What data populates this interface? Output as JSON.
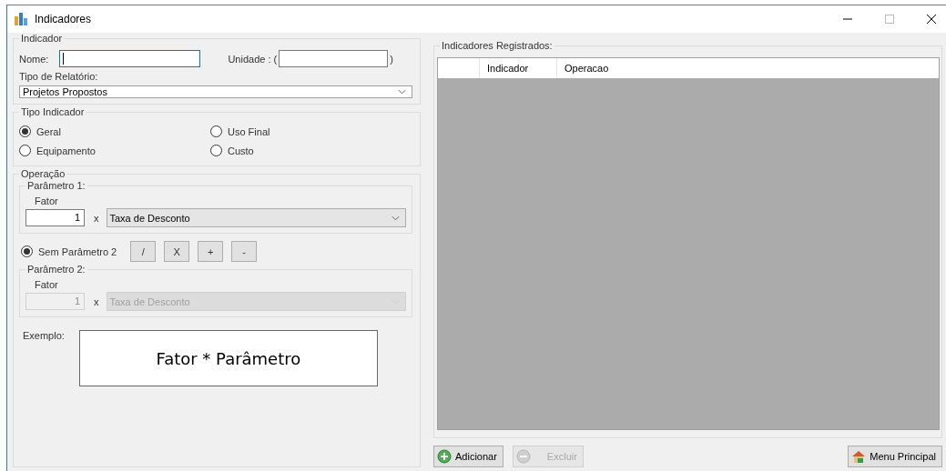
{
  "window": {
    "title": "Indicadores"
  },
  "indicador": {
    "title": "Indicador",
    "nome_label": "Nome:",
    "unidade_label": "Unidade : (",
    "unidade_close": ")",
    "tipo_relatorio_label": "Tipo de Relatório:",
    "tipo_relatorio_value": "Projetos Propostos"
  },
  "tipo_indicador": {
    "title": "Tipo Indicador",
    "options": [
      {
        "label": "Geral",
        "selected": true
      },
      {
        "label": "Uso Final",
        "selected": false
      },
      {
        "label": "Equipamento",
        "selected": false
      },
      {
        "label": "Custo",
        "selected": false
      }
    ]
  },
  "operacao": {
    "title": "Operação",
    "parametros": [
      {
        "title": "Parâmetro 1:",
        "fator_label": "Fator",
        "fator_value": "1",
        "times": "x",
        "select": "Taxa de Desconto",
        "disabled": false
      },
      {
        "title": "Parâmetro 2:",
        "fator_label": "Fator",
        "fator_value": "1",
        "times": "x",
        "select": "Taxa de Desconto",
        "disabled": true
      }
    ],
    "sem_parametro_2": {
      "label": "Sem Parâmetro 2",
      "selected": true
    },
    "operators": [
      {
        "label": "/"
      },
      {
        "label": "X"
      },
      {
        "label": "+"
      },
      {
        "label": "-"
      }
    ],
    "exemplo": {
      "label": "Exemplo:",
      "text": "Fator * Parâmetro"
    }
  },
  "registrados": {
    "title": "Indicadores Registrados:",
    "columns": [
      "Indicador",
      "Operacao"
    ]
  },
  "buttons": [
    {
      "label": "Adicionar",
      "kind": "add",
      "disabled": false
    },
    {
      "label": "Excluir",
      "kind": "remove",
      "disabled": true
    },
    {
      "label": "Menu Principal",
      "kind": "home",
      "disabled": false
    }
  ]
}
